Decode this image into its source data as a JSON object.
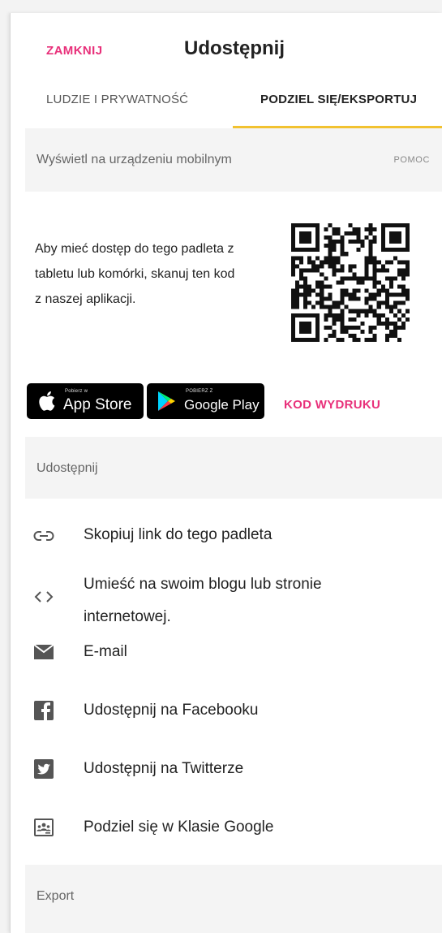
{
  "header": {
    "close_label": "ZAMKNIJ",
    "title": "Udostępnij"
  },
  "tabs": [
    {
      "label": "LUDZIE I PRYWATNOŚĆ",
      "active": false
    },
    {
      "label": "PODZIEL SIĘ/EKSPORTUJ",
      "active": true
    }
  ],
  "mobile": {
    "section_label": "Wyświetl na urządzeniu mobilnym",
    "help_label": "POMOC",
    "description": "Aby mieć dostęp do tego padleta z tabletu lub komórki, skanuj ten kod z naszej aplikacji.",
    "app_store": {
      "small": "Pobierz w",
      "big": "App Store"
    },
    "google_play": {
      "small": "POBIERZ Z",
      "big": "Google Play"
    },
    "print_code_label": "KOD WYDRUKU"
  },
  "share": {
    "section_label": "Udostępnij",
    "items": [
      {
        "icon": "link-icon",
        "label": "Skopiuj link do tego padleta"
      },
      {
        "icon": "code-icon",
        "label": "Umieść na swoim blogu lub stronie internetowej."
      },
      {
        "icon": "email-icon",
        "label": "E-mail"
      },
      {
        "icon": "facebook-icon",
        "label": "Udostępnij na Facebooku"
      },
      {
        "icon": "twitter-icon",
        "label": "Udostępnij na Twitterze"
      },
      {
        "icon": "google-classroom-icon",
        "label": "Podziel się w Klasie Google"
      }
    ]
  },
  "export": {
    "section_label": "Export"
  },
  "colors": {
    "accent_pink": "#e8307a",
    "tab_underline": "#f2c230",
    "icon_grey": "#555555"
  }
}
